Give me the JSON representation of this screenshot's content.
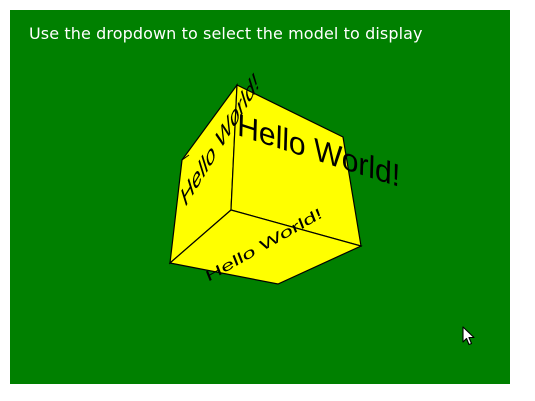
{
  "viewport": {
    "background_color": "#008000"
  },
  "instruction": {
    "text": "Use the dropdown to select the model to display",
    "color": "#ffffff"
  },
  "model": {
    "shape": "cube",
    "face_color": "#ffff00",
    "edge_color": "#000000",
    "faces": {
      "front_right": "Hello World!",
      "left": "Hello World!",
      "bottom": "Hello World!"
    }
  },
  "cursor": {
    "icon": "mouse-pointer-icon"
  }
}
